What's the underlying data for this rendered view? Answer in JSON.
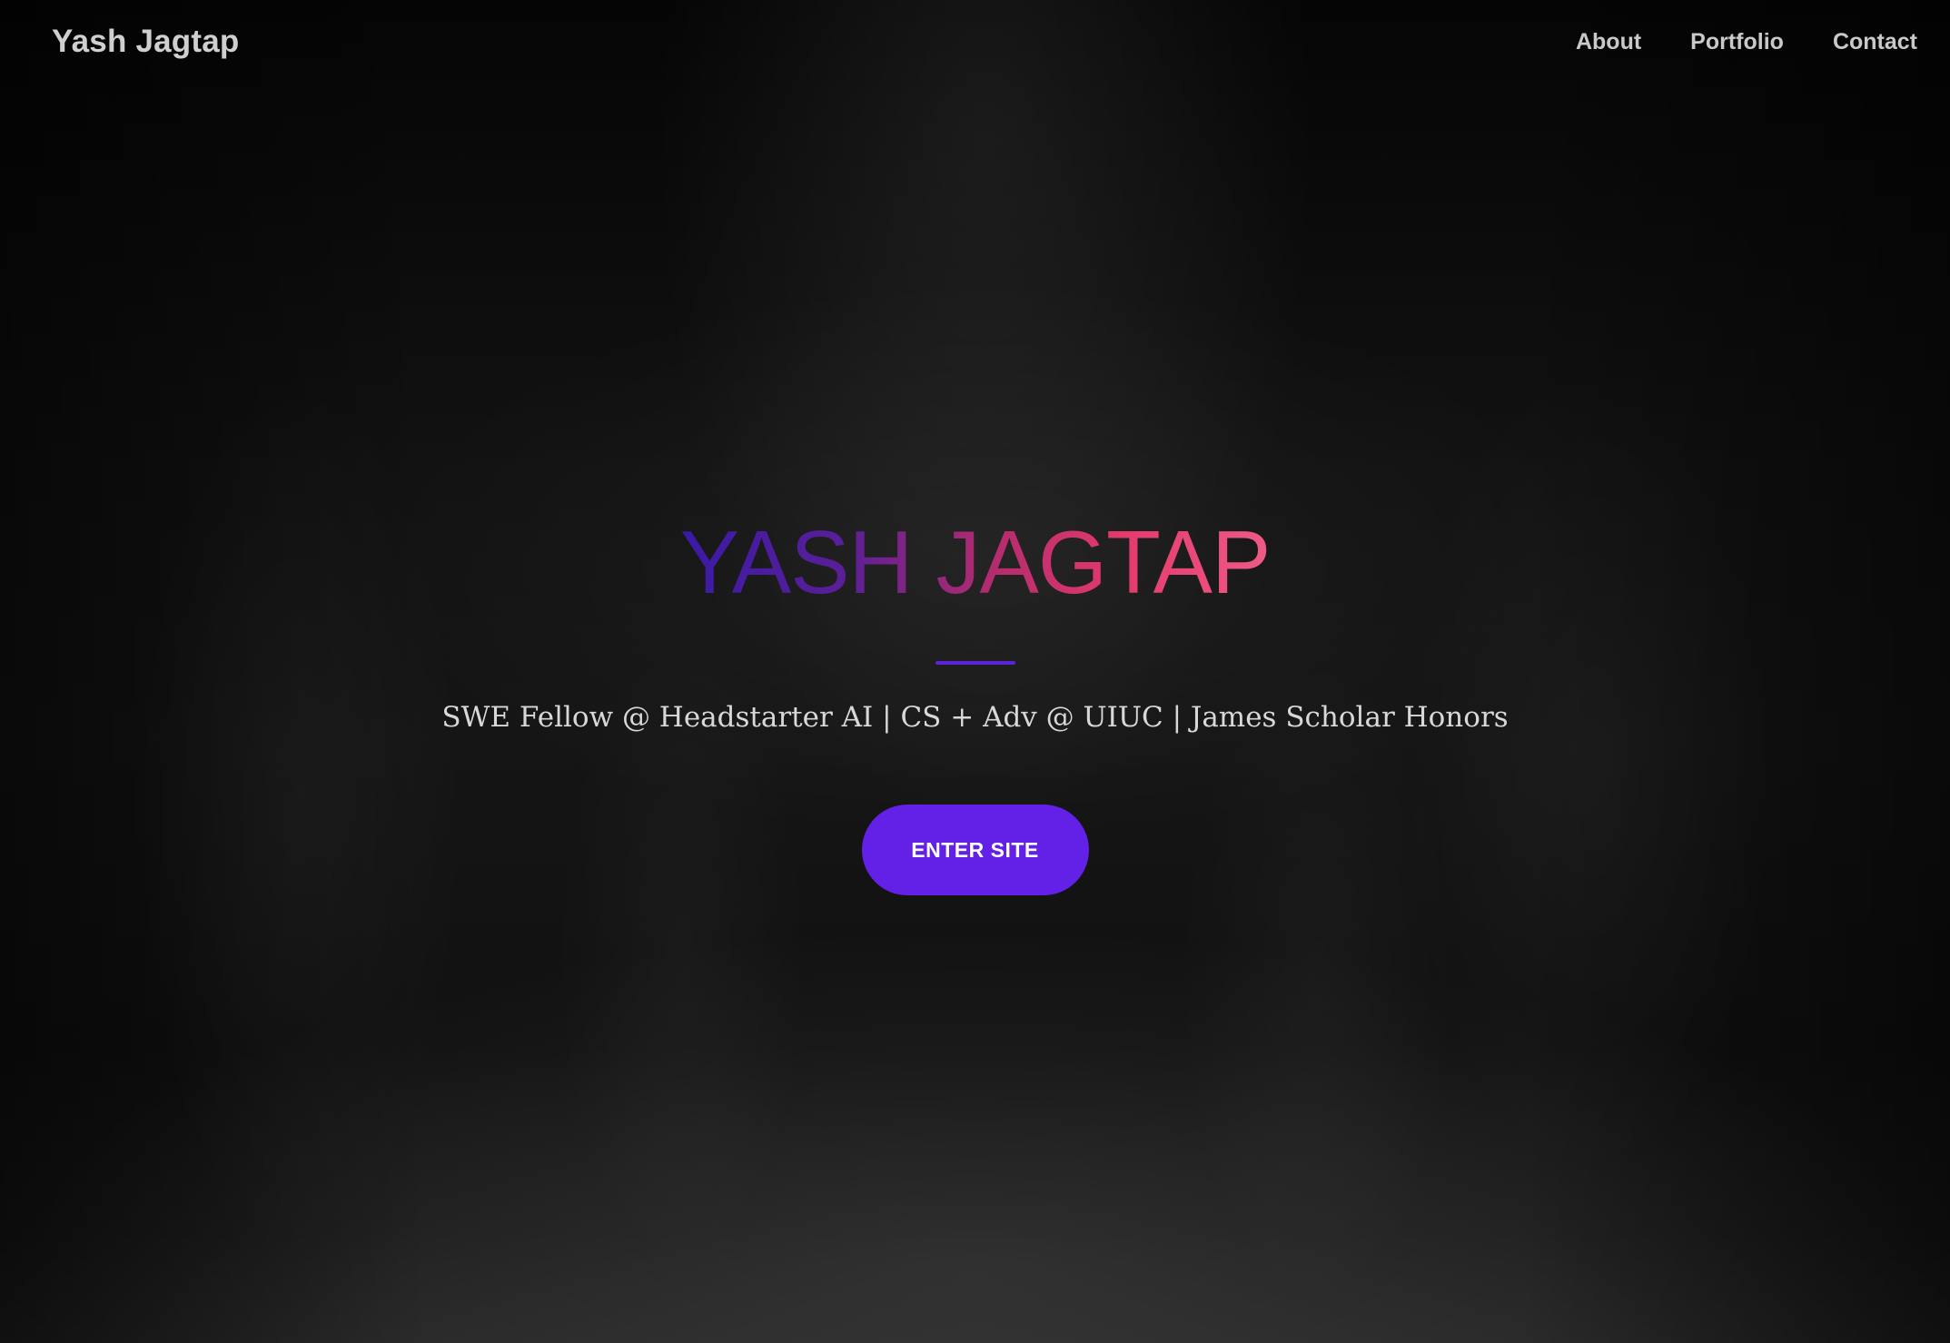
{
  "header": {
    "brand": "Yash Jagtap",
    "nav": [
      {
        "label": "About"
      },
      {
        "label": "Portfolio"
      },
      {
        "label": "Contact"
      }
    ]
  },
  "hero": {
    "title": "YASH JAGTAP",
    "subtitle": "SWE Fellow @ Headstarter AI | CS + Adv @ UIUC | James Scholar Honors",
    "cta_label": "ENTER SITE"
  },
  "colors": {
    "accent": "#6320E6",
    "title_gradient_start": "#3A1AA6",
    "title_gradient_end": "#EE5A86",
    "background": "#121212"
  }
}
